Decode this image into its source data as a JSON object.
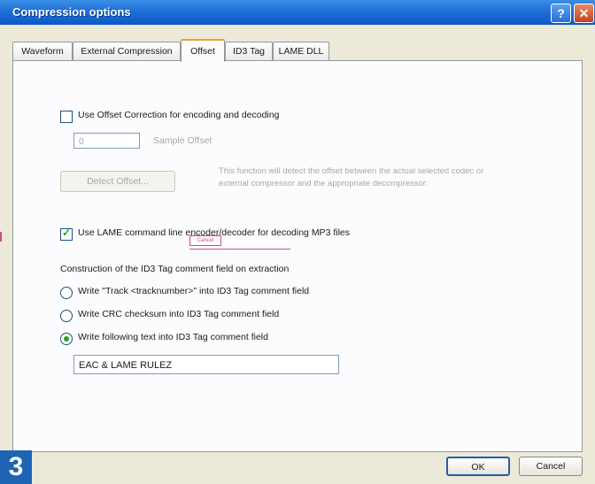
{
  "window": {
    "title": "Compression options",
    "help_glyph": "?",
    "close_glyph": "✕"
  },
  "tabs": [
    {
      "label": "Waveform",
      "active": false
    },
    {
      "label": "External Compression",
      "active": false
    },
    {
      "label": "Offset",
      "active": true
    },
    {
      "label": "ID3 Tag",
      "active": false
    },
    {
      "label": "LAME DLL",
      "active": false
    }
  ],
  "offset": {
    "use_offset_label": "Use Offset Correction for encoding and decoding",
    "use_offset_checked": false,
    "sample_offset_value": "0",
    "sample_offset_label": "Sample Offset",
    "detect_offset_button": "Detect Offset...",
    "detect_offset_desc_line1": "This function will detect the offset between the actual selected codec or",
    "detect_offset_desc_line2": "external compressor and the appropriate decompressor."
  },
  "lame": {
    "use_lame_label": "Use LAME command line encoder/decoder for decoding MP3 files",
    "use_lame_checked": true,
    "popup_label": "Cancel"
  },
  "id3_comment": {
    "heading": "Construction of the ID3 Tag comment field on extraction",
    "options": [
      {
        "label": "Write \"Track <tracknumber>\" into ID3 Tag comment field",
        "selected": false
      },
      {
        "label": "Write CRC checksum into ID3 Tag comment field",
        "selected": false
      },
      {
        "label": "Write following text into ID3 Tag comment field",
        "selected": true
      }
    ],
    "text_value": "EAC & LAME RULEZ"
  },
  "footer": {
    "ok": "OK",
    "cancel": "Cancel",
    "badge": "3"
  },
  "colors": {
    "titlebar": "#1f6fd6",
    "check_green": "#21a121",
    "badge_blue": "#1e64b4"
  }
}
